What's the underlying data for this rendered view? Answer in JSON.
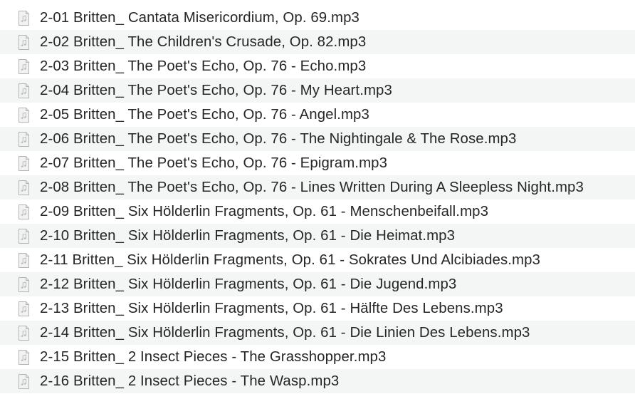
{
  "files": [
    {
      "name": "2-01 Britten_ Cantata Misericordium, Op. 69.mp3",
      "icon": "audio-file-icon"
    },
    {
      "name": "2-02 Britten_ The Children's Crusade, Op. 82.mp3",
      "icon": "audio-file-icon"
    },
    {
      "name": "2-03 Britten_ The Poet's Echo, Op. 76 - Echo.mp3",
      "icon": "audio-file-icon"
    },
    {
      "name": "2-04 Britten_ The Poet's Echo, Op. 76 - My Heart.mp3",
      "icon": "audio-file-icon"
    },
    {
      "name": "2-05 Britten_ The Poet's Echo, Op. 76 - Angel.mp3",
      "icon": "audio-file-icon"
    },
    {
      "name": "2-06 Britten_ The Poet's Echo, Op. 76 - The Nightingale & The Rose.mp3",
      "icon": "audio-file-icon"
    },
    {
      "name": "2-07 Britten_ The Poet's Echo, Op. 76 - Epigram.mp3",
      "icon": "audio-file-icon"
    },
    {
      "name": "2-08 Britten_ The Poet's Echo, Op. 76 - Lines Written During A Sleepless Night.mp3",
      "icon": "audio-file-icon"
    },
    {
      "name": "2-09 Britten_ Six Hölderlin Fragments, Op. 61 - Menschenbeifall.mp3",
      "icon": "audio-file-icon"
    },
    {
      "name": "2-10 Britten_ Six Hölderlin Fragments, Op. 61 - Die Heimat.mp3",
      "icon": "audio-file-icon"
    },
    {
      "name": "2-11 Britten_ Six Hölderlin Fragments, Op. 61 - Sokrates Und Alcibiades.mp3",
      "icon": "audio-file-icon"
    },
    {
      "name": "2-12 Britten_ Six Hölderlin Fragments, Op. 61 - Die Jugend.mp3",
      "icon": "audio-file-icon"
    },
    {
      "name": "2-13 Britten_ Six Hölderlin Fragments, Op. 61 - Hälfte Des Lebens.mp3",
      "icon": "audio-file-icon"
    },
    {
      "name": "2-14 Britten_ Six Hölderlin Fragments, Op. 61 - Die Linien Des Lebens.mp3",
      "icon": "audio-file-icon"
    },
    {
      "name": "2-15 Britten_ 2 Insect Pieces - The Grasshopper.mp3",
      "icon": "audio-file-icon"
    },
    {
      "name": "2-16 Britten_ 2 Insect Pieces - The Wasp.mp3",
      "icon": "audio-file-icon"
    }
  ]
}
